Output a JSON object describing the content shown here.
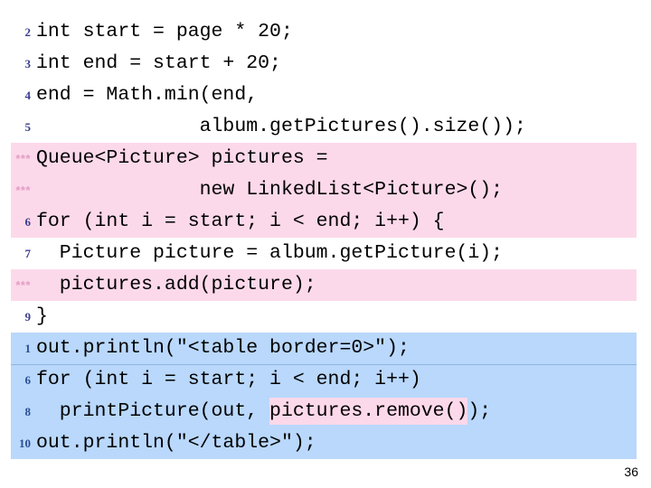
{
  "slide": {
    "page_number": "36",
    "colors": {
      "pink_highlight": "#fcd9ea",
      "blue_highlight": "#b9d8fc",
      "gutter_number": "#3b3b8f",
      "gutter_stars": "#e39ec6",
      "gutter_number_blue": "#2b4f94",
      "code_text": "#000000",
      "background": "#ffffff"
    }
  },
  "code": {
    "lines": [
      {
        "marker": "2",
        "marker_kind": "number",
        "highlight": "none",
        "text": "int start = page * 20;"
      },
      {
        "marker": "3",
        "marker_kind": "number",
        "highlight": "none",
        "text": "int end = start + 20;"
      },
      {
        "marker": "4",
        "marker_kind": "number",
        "highlight": "none",
        "text": "end = Math.min(end,"
      },
      {
        "marker": "5",
        "marker_kind": "number",
        "highlight": "none",
        "text": "              album.getPictures().size());"
      },
      {
        "marker": "***",
        "marker_kind": "stars",
        "highlight": "pink",
        "text": "Queue<Picture> pictures ="
      },
      {
        "marker": "***",
        "marker_kind": "stars",
        "highlight": "pink",
        "text": "              new LinkedList<Picture>();"
      },
      {
        "marker": "6",
        "marker_kind": "number",
        "highlight": "pink",
        "text": "for (int i = start; i < end; i++) {"
      },
      {
        "marker": "7",
        "marker_kind": "number",
        "highlight": "none",
        "text": "  Picture picture = album.getPicture(i);"
      },
      {
        "marker": "***",
        "marker_kind": "stars",
        "highlight": "pink",
        "text": "  pictures.add(picture);"
      },
      {
        "marker": "9",
        "marker_kind": "number",
        "highlight": "none",
        "text": "}"
      },
      {
        "marker": "1",
        "marker_kind": "number",
        "highlight": "blue",
        "text": "out.println(\"<table border=0>\");"
      },
      {
        "marker": "6",
        "marker_kind": "number",
        "highlight": "blue-sep",
        "text": "for (int i = start; i < end; i++)"
      },
      {
        "marker": "8",
        "marker_kind": "number",
        "highlight": "blue",
        "text_before": "  printPicture(out, ",
        "text_highlight": "pictures.remove()",
        "text_after": ");"
      },
      {
        "marker": "10",
        "marker_kind": "number",
        "highlight": "blue",
        "text": "out.println(\"</table>\");"
      }
    ]
  }
}
